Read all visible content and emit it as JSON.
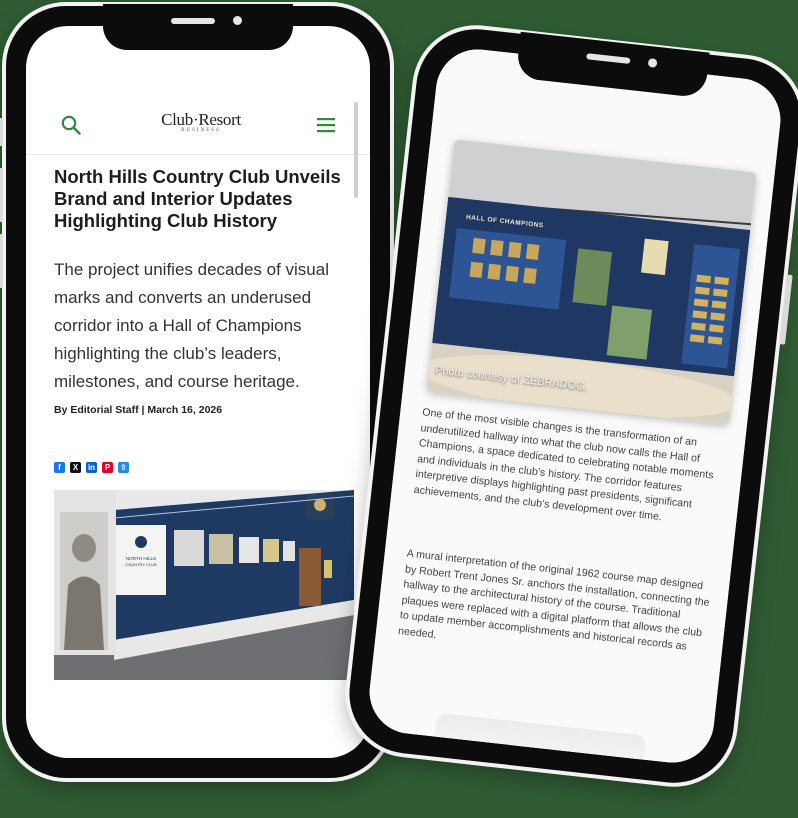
{
  "left_phone": {
    "header": {
      "search_icon": "search-icon",
      "logo_main": "Club·Resort",
      "logo_sub": "BUSINESS",
      "menu_icon": "hamburger-menu-icon",
      "accent_color": "#2e8b3e"
    },
    "article": {
      "title": "North Hills Country Club Unveils Brand and Interior Updates Highlighting Club History",
      "deck": "The project unifies decades of visual marks and converts an underused corridor into a Hall of Champions highlighting the club’s leaders, milestones, and course heritage.",
      "byline": "By Editorial Staff | March 16, 2026"
    },
    "share": [
      {
        "icon": "facebook-icon",
        "color": "#1877f2",
        "glyph": "f"
      },
      {
        "icon": "x-icon",
        "color": "#111111",
        "glyph": "X"
      },
      {
        "icon": "linkedin-icon",
        "color": "#0a66c2",
        "glyph": "in"
      },
      {
        "icon": "pinterest-icon",
        "color": "#e60023",
        "glyph": "P"
      },
      {
        "icon": "share-icon",
        "color": "#1f8ce6",
        "glyph": "⇧"
      }
    ],
    "hero_image": {
      "sign_line1": "NORTH HILLS",
      "sign_line2": "COUNTRY CLUB"
    }
  },
  "right_phone": {
    "photo": {
      "wall_heading": "HALL OF CHAMPIONS",
      "credit": "Photo courtesy of ZEBRADOG."
    },
    "paragraphs": [
      "One of the most visible changes is the transformation of an underutilized hallway into what the club now calls the Hall of Champions, a space dedicated to celebrating notable moments and individuals in the club’s history. The corridor features interpretive displays highlighting past presidents, significant achievements, and the club’s development over time.",
      "A mural interpretation of the original 1962 course map designed by Robert Trent Jones Sr. anchors the installation, connecting the hallway to the architectural history of the course. Traditional plaques were replaced with a digital platform that allows the club to update member accomplishments and historical records as needed."
    ]
  }
}
